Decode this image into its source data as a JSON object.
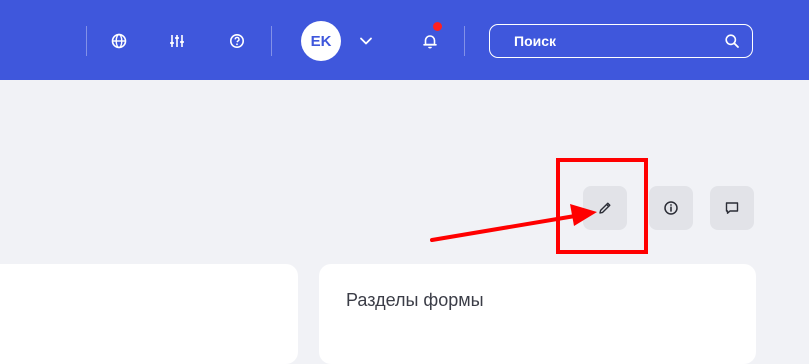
{
  "header": {
    "avatar_initials": "EK",
    "search": {
      "placeholder": "Поиск"
    },
    "icons": [
      "globe-icon",
      "sliders-icon",
      "help-icon",
      "chevron-down-icon",
      "bell-icon",
      "search-icon"
    ],
    "colors": {
      "background": "#3f57dc",
      "notification": "#ff2020"
    }
  },
  "toolbar": {
    "buttons": [
      "edit-button",
      "info-button",
      "comments-button"
    ]
  },
  "form_sections": {
    "title": "Разделы формы"
  },
  "annotation": {
    "color": "#ff0000",
    "target": "edit-button"
  }
}
